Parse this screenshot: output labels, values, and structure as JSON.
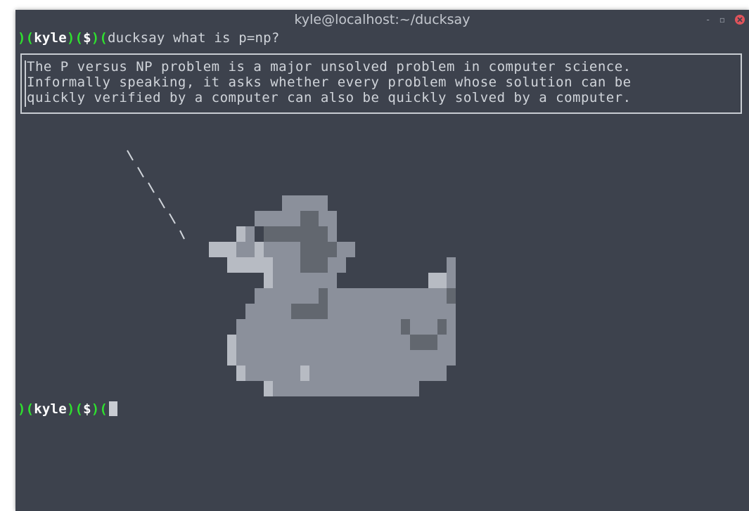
{
  "window": {
    "title": "kyle@localhost:~/ducksay"
  },
  "controls": {
    "minimize": "-",
    "maximize": "▫"
  },
  "prompt1": {
    "p1": ")(",
    "user": "kyle",
    "p2": ")(",
    "sym": "$",
    "p3": ")(",
    "command": "ducksay what is p=np?"
  },
  "output": {
    "lines": [
      "The P versus NP problem is a major unsolved problem in computer science.",
      "Informally speaking, it asks whether every problem whose solution can be",
      "quickly verified by a computer can also be quickly solved by a computer."
    ]
  },
  "prompt2": {
    "p1": ")(",
    "user": "kyle",
    "p2": ")(",
    "sym": "$",
    "p3": ")("
  },
  "colors": {
    "bg": "#3d424d",
    "prompt_green": "#2fe02f",
    "text": "#d0d4da"
  }
}
